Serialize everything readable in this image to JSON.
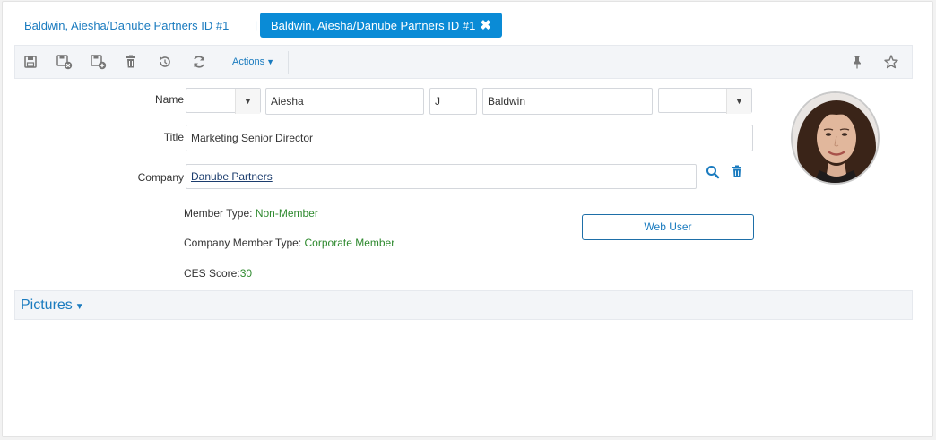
{
  "tabs": {
    "inactive_label": "Baldwin, Aiesha/Danube Partners ID #1",
    "separator": "|",
    "active_label": "Baldwin, Aiesha/Danube Partners ID #1",
    "close_glyph": "✖"
  },
  "toolbar": {
    "icons": [
      "save-icon",
      "save-close-icon",
      "save-new-icon",
      "delete-icon",
      "undo-icon",
      "refresh-icon",
      "pin-icon",
      "star-icon"
    ],
    "actions_label": "Actions",
    "actions_caret": "▼"
  },
  "form": {
    "name_label": "Name",
    "prefix_value": "",
    "first_name": "Aiesha",
    "middle_initial": "J",
    "last_name": "Baldwin",
    "suffix_value": "",
    "title_label": "Title",
    "title_value": "Marketing Senior Director",
    "company_label": "Company",
    "company_value": "Danube Partners",
    "member_type_label": "Member Type: ",
    "member_type_value": "Non-Member",
    "company_member_type_label": "Company Member Type: ",
    "company_member_type_value": "Corporate Member",
    "ces_label": "CES Score:",
    "ces_value": "30",
    "web_user_button": "Web User"
  },
  "sections": {
    "pictures_label": "Pictures",
    "pictures_caret": "▼"
  },
  "colors": {
    "accent": "#1a7bbf",
    "active_tab": "#0a8bd6",
    "value_green": "#2f8a2f"
  }
}
